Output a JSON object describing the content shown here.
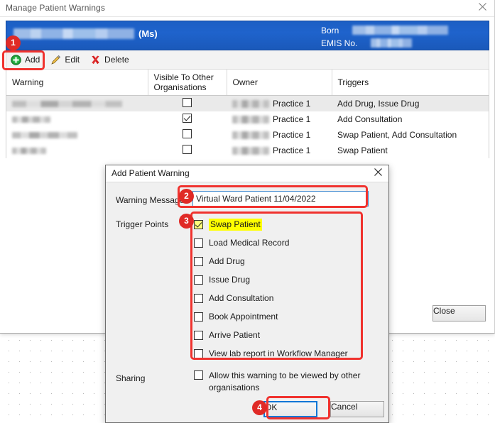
{
  "window": {
    "title": "Manage Patient Warnings",
    "close_icon": "close-icon",
    "close_button_label": "Close"
  },
  "patient_banner": {
    "name_redacted": "",
    "title_suffix": "(Ms)",
    "born_label": "Born",
    "born_value_redacted": "",
    "emis_label": "EMIS No.",
    "emis_value_redacted": ""
  },
  "toolbar": {
    "items": [
      {
        "label": "Add",
        "icon": "add-plus-icon"
      },
      {
        "label": "Edit",
        "icon": "pencil-icon"
      },
      {
        "label": "Delete",
        "icon": "red-x-icon"
      }
    ]
  },
  "grid": {
    "columns": [
      "Warning",
      "Visible To Other Organisations",
      "Owner",
      "Triggers"
    ],
    "rows": [
      {
        "warning_redacted": "",
        "visible": false,
        "owner_redacted": "",
        "owner": "Practice 1",
        "triggers": "Add Drug, Issue Drug"
      },
      {
        "warning_redacted": "",
        "visible": true,
        "owner_redacted": "",
        "owner": "Practice 1",
        "triggers": "Add Consultation"
      },
      {
        "warning_redacted": "",
        "visible": false,
        "owner_redacted": "",
        "owner": "Practice 1",
        "triggers": "Swap Patient, Add Consultation"
      },
      {
        "warning_redacted": "",
        "visible": false,
        "owner_redacted": "",
        "owner": "Practice 1",
        "triggers": "Swap Patient"
      }
    ]
  },
  "dialog": {
    "title": "Add Patient Warning",
    "close_icon": "close-icon",
    "warning_message_label": "Warning Message",
    "warning_message_value": "Virtual Ward Patient 11/04/2022",
    "warning_message_placeholder": "",
    "trigger_points_label": "Trigger Points",
    "trigger_points": [
      {
        "label": "Swap Patient",
        "checked": true,
        "highlighted": true
      },
      {
        "label": "Load Medical Record",
        "checked": false,
        "highlighted": false
      },
      {
        "label": "Add Drug",
        "checked": false,
        "highlighted": false
      },
      {
        "label": "Issue Drug",
        "checked": false,
        "highlighted": false
      },
      {
        "label": "Add Consultation",
        "checked": false,
        "highlighted": false
      },
      {
        "label": "Book Appointment",
        "checked": false,
        "highlighted": false
      },
      {
        "label": "Arrive Patient",
        "checked": false,
        "highlighted": false
      },
      {
        "label": "View lab report in Workflow Manager",
        "checked": false,
        "highlighted": false
      }
    ],
    "sharing_label": "Sharing",
    "sharing_checkbox_label": "Allow this warning to be viewed by other organisations",
    "sharing_checked": false,
    "ok_label": "OK",
    "cancel_label": "Cancel"
  },
  "annotations": {
    "accent_color": "#e02a26",
    "highlight_color": "#ffff00",
    "steps": [
      {
        "number": "1",
        "target": "Add toolbar button"
      },
      {
        "number": "2",
        "target": "Warning Message field"
      },
      {
        "number": "3",
        "target": "Trigger Points list"
      },
      {
        "number": "4",
        "target": "OK button"
      }
    ]
  }
}
